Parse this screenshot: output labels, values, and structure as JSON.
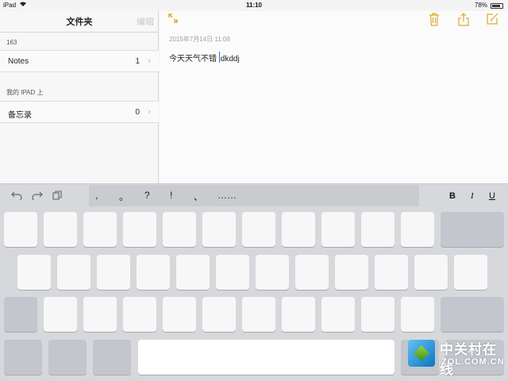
{
  "status_bar": {
    "device": "iPad",
    "time": "11:10",
    "battery": "78%"
  },
  "sidebar": {
    "title": "文件夹",
    "edit_label": "编辑",
    "sections": [
      {
        "label": "163",
        "folders": [
          {
            "name": "Notes",
            "count": "1"
          }
        ]
      },
      {
        "label": "我的 IPAD 上",
        "folders": [
          {
            "name": "备忘录",
            "count": "0"
          }
        ]
      }
    ]
  },
  "note": {
    "date": "2015年7月14日 11:08",
    "text_before_cursor": "今天天气不错 ",
    "text_after_cursor": "dkddj"
  },
  "toolbar_icons": [
    "expand-icon",
    "trash-icon",
    "share-icon",
    "compose-icon"
  ],
  "accent_color": "#e0a92c",
  "keyboard": {
    "punctuation": [
      ",",
      "。",
      "?",
      "!",
      "、",
      "……"
    ],
    "format": {
      "bold": "B",
      "italic": "I",
      "underline": "U"
    }
  },
  "watermark": {
    "cn": "中关村在线",
    "en": "ZOL.COM.CN"
  }
}
